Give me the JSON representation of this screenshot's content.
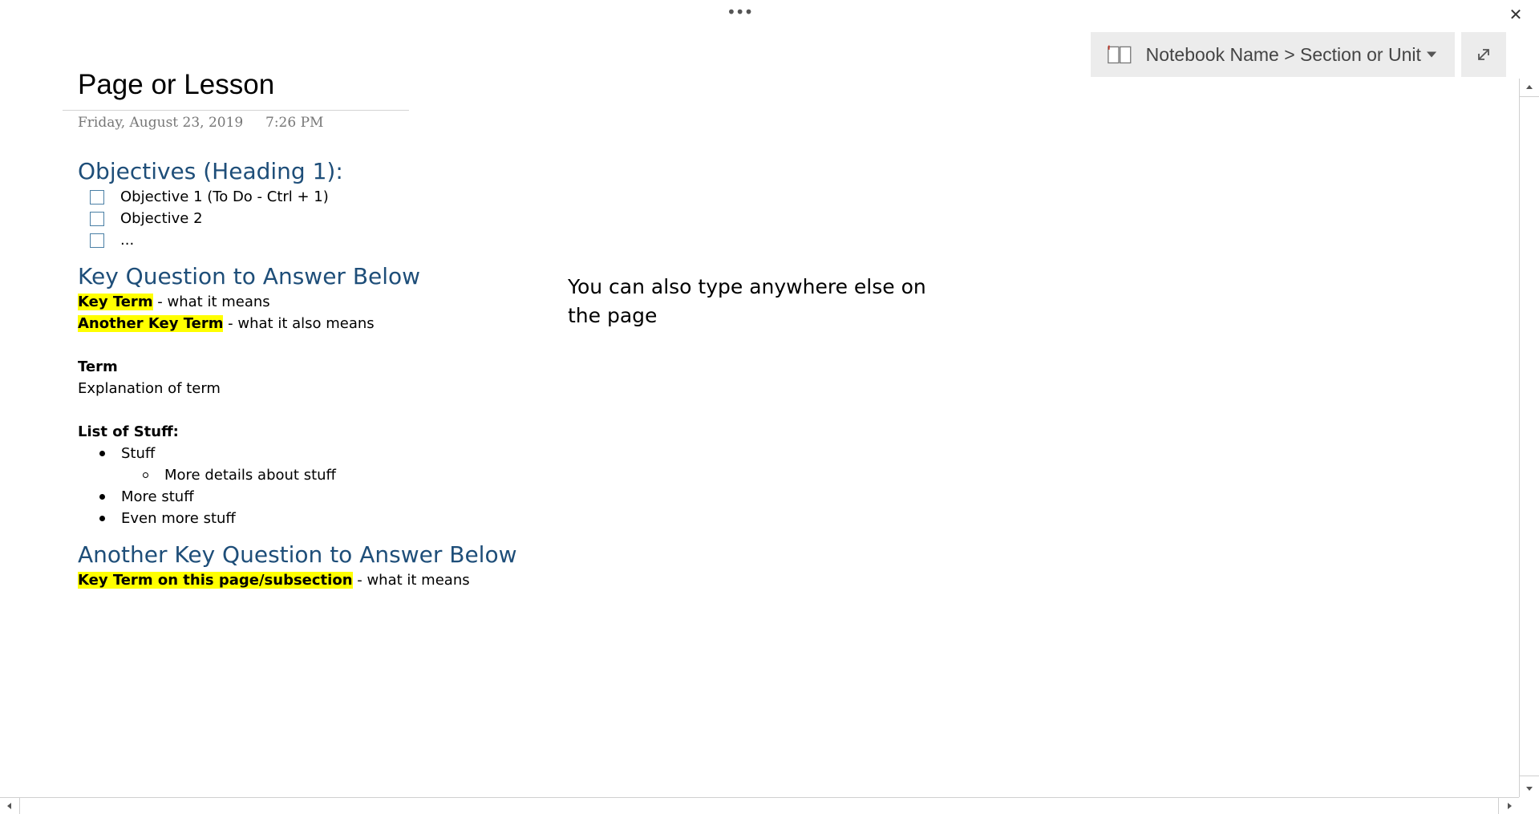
{
  "toolbar": {
    "more_icon": "more-horizontal-icon",
    "more_glyph": "•••",
    "close_icon": "close-icon",
    "close_glyph": "✕",
    "notebook_icon": "notebook-icon",
    "breadcrumb": "Notebook Name > Section or Unit",
    "dropdown_icon": "caret-down-icon",
    "expand_icon": "expand-icon"
  },
  "page": {
    "title": "Page or Lesson",
    "date": "Friday, August 23, 2019",
    "time": "7:26 PM"
  },
  "objectives": {
    "heading": "Objectives (Heading 1):",
    "items": [
      "Objective 1 (To Do - Ctrl + 1)",
      "Objective 2",
      "..."
    ]
  },
  "key_question_1": {
    "heading": "Key Question to Answer Below",
    "terms": [
      {
        "term": "Key Term",
        "definition": " - what it means"
      },
      {
        "term": "Another Key Term",
        "definition": " - what it also means"
      }
    ]
  },
  "term_block": {
    "term": "Term",
    "explanation": "Explanation of term"
  },
  "list_block": {
    "label": "List of Stuff:",
    "items": [
      "Stuff",
      "More details about stuff",
      "More stuff",
      "Even more stuff"
    ]
  },
  "key_question_2": {
    "heading": "Another Key Question to Answer Below",
    "term": "Key Term on this page/subsection",
    "definition": " - what it means"
  },
  "free_note": "You can also type anywhere else on the page",
  "colors": {
    "heading": "#1e4e79",
    "highlight": "#ffff00",
    "notebook_bar": "#ececec"
  }
}
